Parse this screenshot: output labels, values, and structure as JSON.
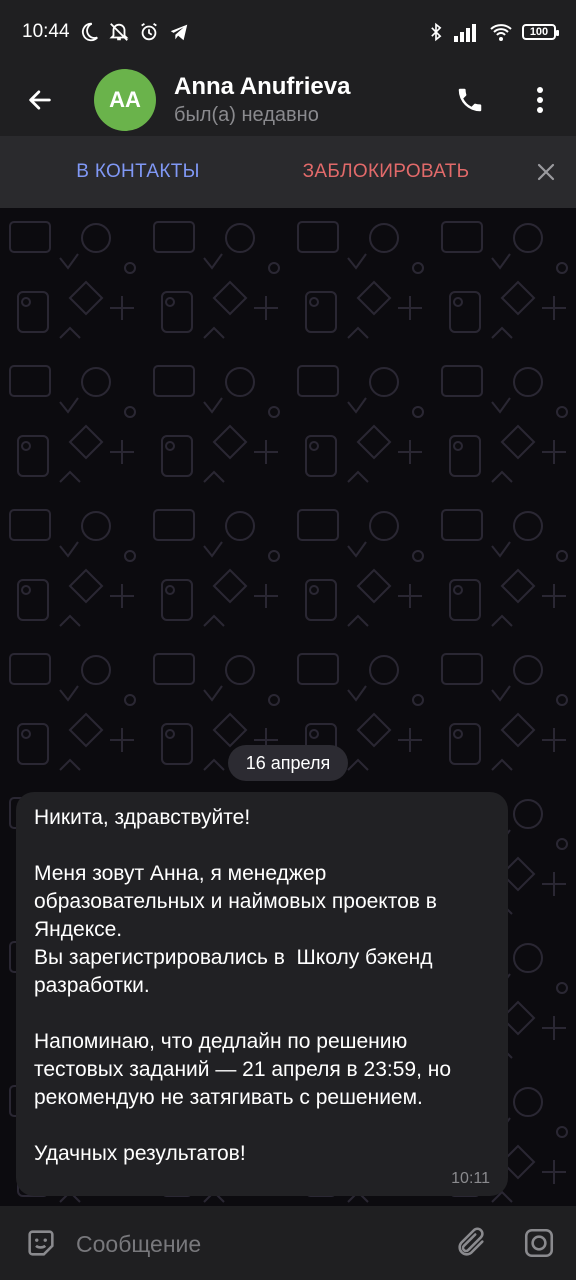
{
  "status_bar": {
    "time": "10:44",
    "battery": "100",
    "left_icons": [
      "moon-icon",
      "notifications-off-icon",
      "alarm-icon",
      "telegram-icon"
    ],
    "right_icons": [
      "bluetooth-icon",
      "signal-icon",
      "wifi-icon",
      "battery-icon"
    ]
  },
  "header": {
    "avatar_initials": "AA",
    "avatar_color": "#6ab34b",
    "name": "Anna Anufrieva",
    "status": "был(а) недавно"
  },
  "action_bar": {
    "add_contact": "В КОНТАКТЫ",
    "block": "ЗАБЛОКИРОВАТЬ",
    "add_contact_color": "#8098f5",
    "block_color": "#e26a6a"
  },
  "chat": {
    "date": "16 апреля",
    "message": {
      "text": "Никита, здравствуйте!\n\nМеня зовут Анна, я менеджер образовательных и наймовых проектов в Яндексе.\nВы зарегистрировались в  Школу бэкенд разработки.\n\nНапоминаю, что дедлайн по решению тестовых заданий — 21 апреля в 23:59, но рекомендую не затягивать с решением.\n\nУдачных результатов!",
      "time": "10:11"
    }
  },
  "input": {
    "placeholder": "Сообщение"
  }
}
